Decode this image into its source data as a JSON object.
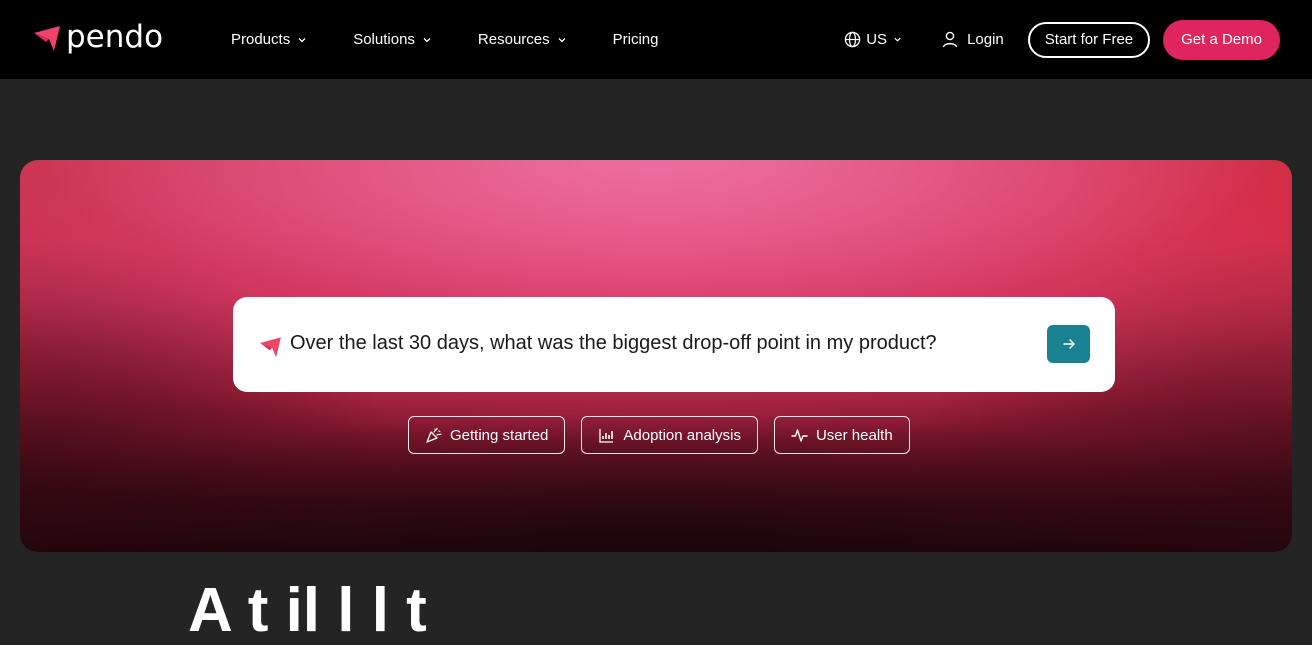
{
  "header": {
    "logo_text": "pendo",
    "nav": [
      {
        "label": "Products",
        "has_dropdown": true
      },
      {
        "label": "Solutions",
        "has_dropdown": true
      },
      {
        "label": "Resources",
        "has_dropdown": true
      },
      {
        "label": "Pricing",
        "has_dropdown": false
      }
    ],
    "locale": "US",
    "login_label": "Login",
    "start_free_label": "Start for Free",
    "demo_label": "Get a Demo"
  },
  "hero": {
    "query": "Over the last 30 days, what was the biggest drop-off point in my product?",
    "chips": [
      {
        "label": "Getting started",
        "icon": "party-popper-icon"
      },
      {
        "label": "Adoption analysis",
        "icon": "chart-icon"
      },
      {
        "label": "User health",
        "icon": "pulse-icon"
      }
    ]
  },
  "headline": "A                  t        il l               l      t",
  "colors": {
    "brand_pink": "#e0245e",
    "send_teal": "#1a8391",
    "header_bg": "#000000",
    "page_bg": "#242424"
  }
}
